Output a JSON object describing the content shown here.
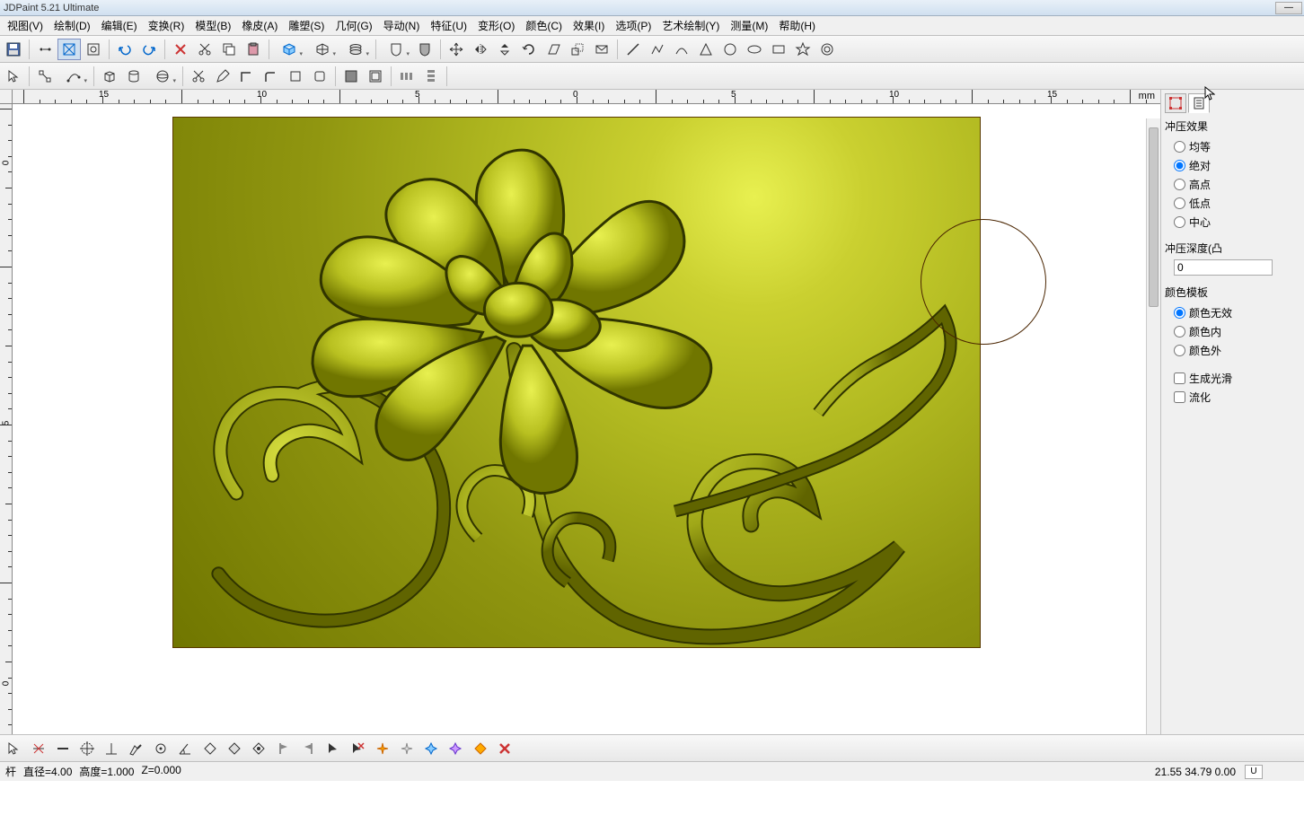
{
  "title": "JDPaint 5.21 Ultimate",
  "menu": [
    "视图(V)",
    "绘制(D)",
    "编辑(E)",
    "变换(R)",
    "模型(B)",
    "橡皮(A)",
    "雕塑(S)",
    "几何(G)",
    "导动(N)",
    "特征(U)",
    "变形(O)",
    "颜色(C)",
    "效果(I)",
    "选项(P)",
    "艺术绘制(Y)",
    "测量(M)",
    "帮助(H)"
  ],
  "ruler": {
    "unit": "mm",
    "h": [
      "15",
      "10",
      "5",
      "0",
      "5",
      "10",
      "15"
    ],
    "v": [
      "0",
      "5",
      "0"
    ]
  },
  "side": {
    "stamp_effect": {
      "hdr": "冲压效果",
      "opts": [
        "均等",
        "绝对",
        "高点",
        "低点",
        "中心"
      ],
      "selected": 1
    },
    "depth": {
      "hdr": "冲压深度(凸",
      "value": "0"
    },
    "color_tpl": {
      "hdr": "颜色模板",
      "opts": [
        "颜色无效",
        "颜色内",
        "颜色外"
      ],
      "selected": 0
    },
    "smooth": "生成光滑",
    "flow": "流化"
  },
  "status": {
    "left1": "杆",
    "diam": "直径=4.00",
    "height": "高度=1.000",
    "z": "Z=0.000",
    "coords": "21.55 34.79 0.00",
    "ubtn": "U"
  }
}
